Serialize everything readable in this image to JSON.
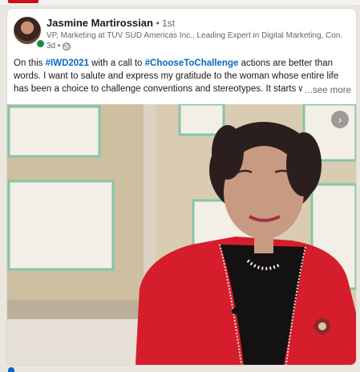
{
  "author": {
    "name": "Jasmine Martirossian",
    "degree": "• 1st",
    "headline": "VP, Marketing at TÜV SÜD Americas Inc., Leading Expert in Digital Marketing, Con...",
    "time": "3d •"
  },
  "post": {
    "segments": [
      "On this ",
      "#IWD2021",
      " with a call to ",
      "#ChooseToChallenge",
      " actions are better than words. I want to salute and express my gratitude to the woman whose entire life has been a choice to challenge conventions and stereotypes. It starts w"
    ],
    "see_more": "...see more"
  },
  "icons": {
    "presence": "online-status-icon",
    "globe": "globe-icon",
    "next": "chevron-right-icon"
  },
  "colors": {
    "link": "#0a66c2",
    "presence": "#1a8b3f",
    "jacket": "#d51d2b"
  }
}
